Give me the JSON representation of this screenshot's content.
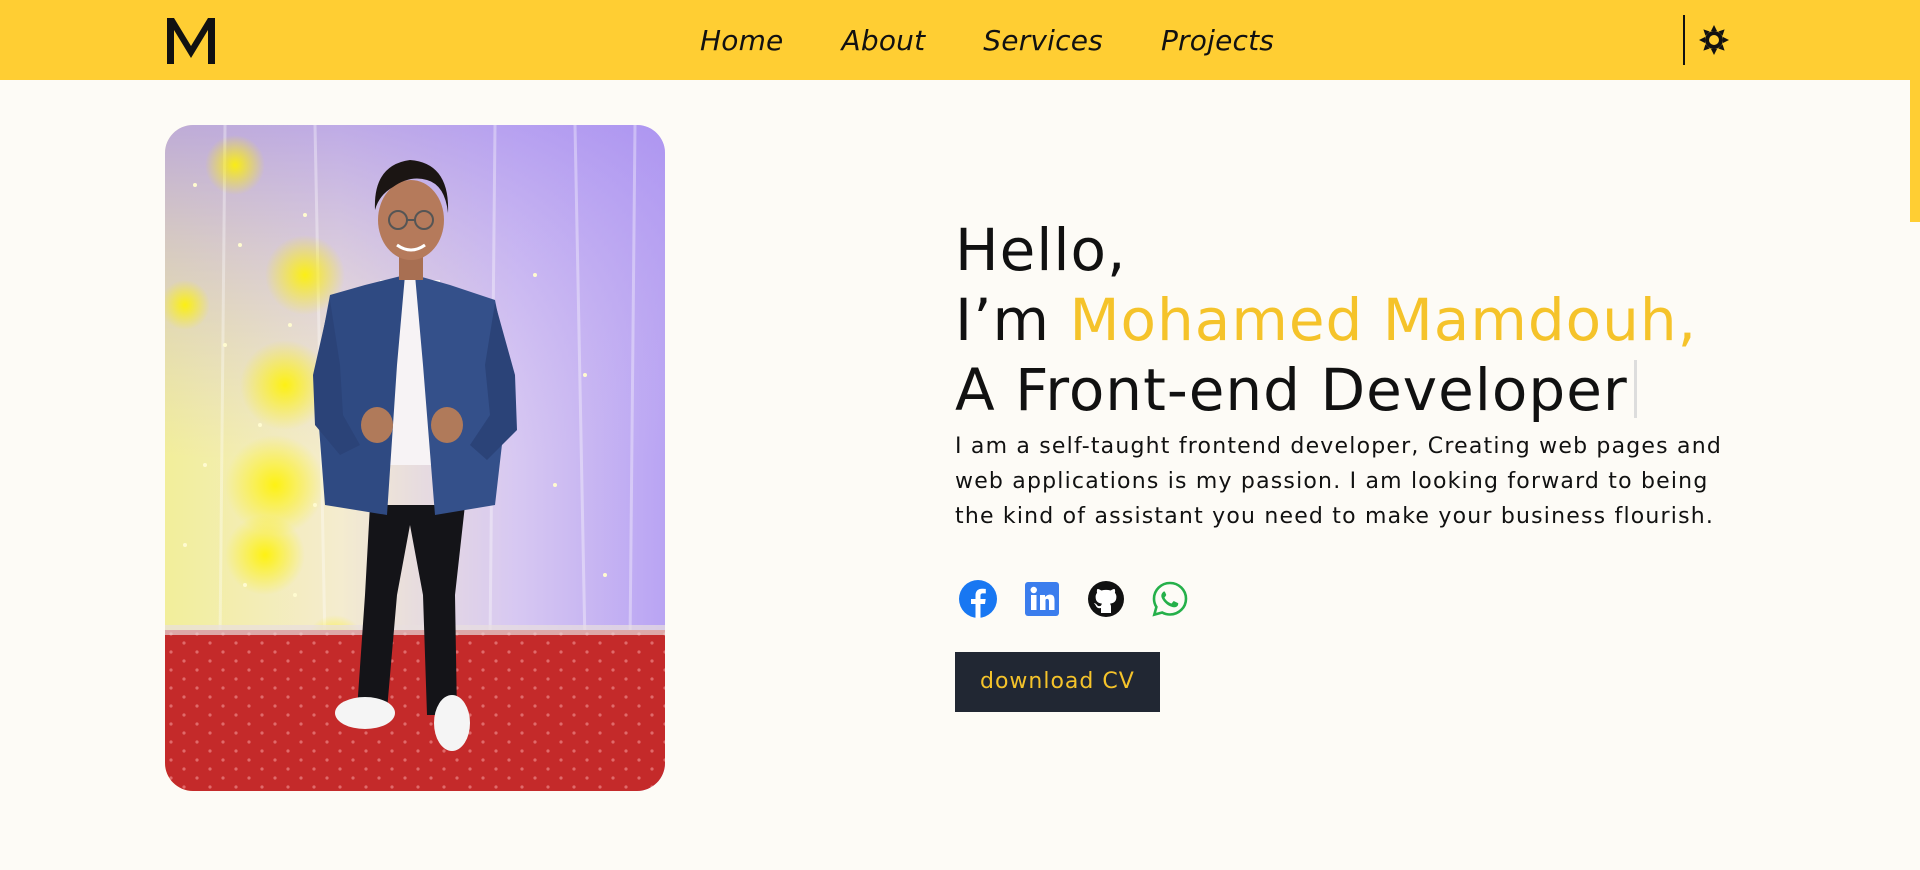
{
  "nav": {
    "logo_letter": "M",
    "links": [
      {
        "label": "Home"
      },
      {
        "label": "About"
      },
      {
        "label": "Services"
      },
      {
        "label": "Projects"
      }
    ],
    "theme_icon": "sun-icon"
  },
  "hero": {
    "greeting": "Hello,",
    "intro": "I’m",
    "name": "Mohamed Mamdouh,",
    "role": "A Front-end Developer",
    "bio": "I am a self-taught frontend developer, Creating web pages and web applications is my passion. I am looking forward to being the kind of assistant you need to make your business flourish.",
    "socials": [
      {
        "icon": "facebook-icon"
      },
      {
        "icon": "linkedin-icon"
      },
      {
        "icon": "github-icon"
      },
      {
        "icon": "whatsapp-icon"
      }
    ],
    "cv_label": "download CV"
  },
  "colors": {
    "accent": "#ffce33",
    "name": "#f5c32a",
    "button_bg": "#212733",
    "background": "#fdfbf6"
  }
}
